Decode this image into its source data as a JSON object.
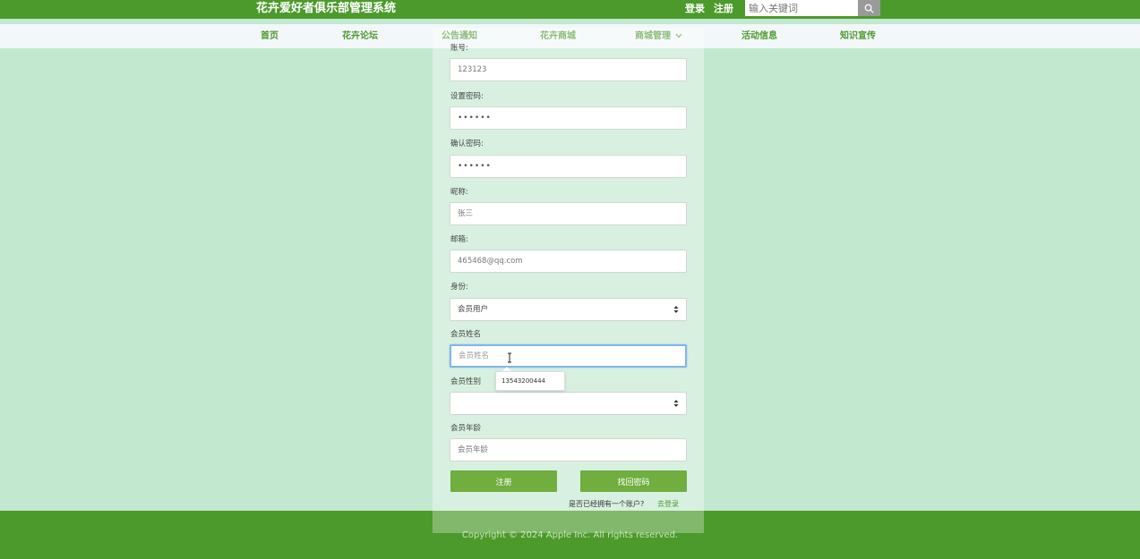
{
  "header": {
    "title": "花卉爱好者俱乐部管理系统",
    "login": "登录",
    "register": "注册",
    "search_placeholder": "输入关键词",
    "search_icon": "search-icon"
  },
  "nav": {
    "items": [
      "首页",
      "花卉论坛",
      "公告通知",
      "花卉商城",
      "商城管理",
      "活动信息",
      "知识宣传"
    ],
    "dropdown_icon": "chevron-down-icon"
  },
  "form": {
    "account": {
      "label": "账号:",
      "value": "123123"
    },
    "password": {
      "label": "设置密码:",
      "value": "••••••"
    },
    "confirm_password": {
      "label": "确认密码:",
      "value": "••••••"
    },
    "nickname": {
      "label": "昵称:",
      "value": "张三"
    },
    "email": {
      "label": "邮箱:",
      "value": "465468@qq.com"
    },
    "role": {
      "label": "身份:",
      "value": "会员用户"
    },
    "member_name": {
      "label": "会员姓名",
      "placeholder": "会员姓名"
    },
    "autocomplete_suggestion": "13543200444",
    "member_gender": {
      "label": "会员性别",
      "value": ""
    },
    "member_age": {
      "label": "会员年龄",
      "placeholder": "会员年龄"
    },
    "register_button": "注册",
    "recover_button": "找回密码",
    "login_prompt": "是否已经拥有一个账户?",
    "login_link": "去登录"
  },
  "footer": {
    "copyright": "Copyright © 2024 Apple Inc. All rights reserved."
  },
  "colors": {
    "primary_green": "#4c9a2c",
    "button_green": "#6fae3f",
    "background": "#c3e8d0",
    "focus_border": "#7fb7e6"
  }
}
